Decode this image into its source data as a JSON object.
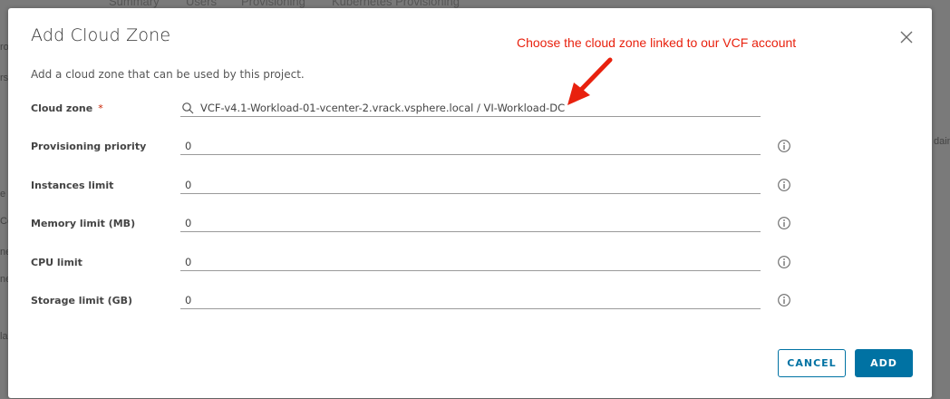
{
  "background": {
    "tabs": [
      "Summary",
      "Users",
      "Provisioning",
      "Kubernetes Provisioning"
    ],
    "side_fragments": [
      "ro",
      "rs",
      "e",
      "Co",
      "ne",
      "ne",
      "la"
    ],
    "right_fragment": "dain"
  },
  "dialog": {
    "title": "Add Cloud Zone",
    "subtitle": "Add a cloud zone that can be used by this project.",
    "annotation": "Choose the cloud zone linked to our VCF account",
    "annotation_color": "#e8210e",
    "accent_color": "#0072a3",
    "fields": {
      "cloud_zone": {
        "label": "Cloud zone",
        "required_marker": "*",
        "value": "VCF-v4.1-Workload-01-vcenter-2.vrack.vsphere.local / VI-Workload-DC",
        "icon": "search-icon"
      },
      "provisioning_priority": {
        "label": "Provisioning priority",
        "value": "0",
        "icon": "info-icon"
      },
      "instances_limit": {
        "label": "Instances limit",
        "value": "0",
        "icon": "info-icon"
      },
      "memory_limit": {
        "label": "Memory limit (MB)",
        "value": "0",
        "icon": "info-icon"
      },
      "cpu_limit": {
        "label": "CPU limit",
        "value": "0",
        "icon": "info-icon"
      },
      "storage_limit": {
        "label": "Storage limit (GB)",
        "value": "0",
        "icon": "info-icon"
      }
    },
    "buttons": {
      "cancel": "CANCEL",
      "add": "ADD"
    }
  }
}
